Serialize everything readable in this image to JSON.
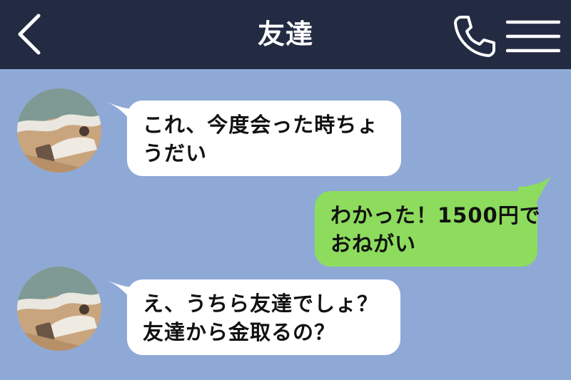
{
  "header": {
    "title": "友達",
    "back_icon": "chevron-left-icon",
    "call_icon": "phone-icon",
    "menu_icon": "hamburger-menu-icon",
    "background_color": "#222b42"
  },
  "chat": {
    "background_color": "#8fa9d7",
    "messages": [
      {
        "direction": "incoming",
        "lines": [
          "これ、今度会った時ちょ",
          "うだい"
        ]
      },
      {
        "direction": "outgoing",
        "lines": [
          "わかった！1500円で",
          "おねがい"
        ]
      },
      {
        "direction": "incoming",
        "lines": [
          "え、うちら友達でしょ？",
          "友達から金取るの？"
        ]
      }
    ],
    "incoming_bubble_color": "#ffffff",
    "outgoing_bubble_color": "#8ddc5d"
  }
}
